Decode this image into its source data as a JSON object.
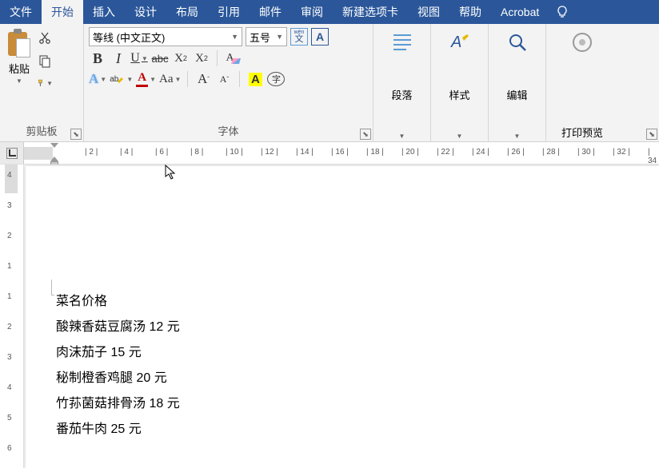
{
  "menu": {
    "file": "文件",
    "home": "开始",
    "insert": "插入",
    "design": "设计",
    "layout": "布局",
    "references": "引用",
    "mailings": "邮件",
    "review": "审阅",
    "new_tab": "新建选项卡",
    "view": "视图",
    "help": "帮助",
    "acrobat": "Acrobat"
  },
  "ribbon": {
    "clipboard": {
      "paste": "粘贴",
      "group_label": "剪贴板"
    },
    "font": {
      "name": "等线 (中文正文)",
      "size": "五号",
      "wen_top": "wén",
      "wen_bottom": "文",
      "group_label": "字体",
      "aa": "Aa"
    },
    "paragraph": {
      "label": "段落"
    },
    "styles": {
      "label": "样式"
    },
    "editing": {
      "label": "编辑"
    },
    "print_preview": {
      "label": "打印预览"
    }
  },
  "ruler": {
    "ticks": [
      "2",
      "4",
      "6",
      "8",
      "10",
      "12",
      "14",
      "16",
      "18",
      "20",
      "22",
      "24",
      "26",
      "28",
      "30",
      "32",
      "34"
    ]
  },
  "v_ruler": {
    "ticks": [
      "4",
      "3",
      "2",
      "1",
      "1",
      "2",
      "3",
      "4",
      "5",
      "6"
    ]
  },
  "document": {
    "lines": [
      "菜名价格",
      "酸辣香菇豆腐汤 12 元",
      "肉沫茄子 15 元",
      "秘制橙香鸡腿 20 元",
      "竹荪菌菇排骨汤 18 元",
      "番茄牛肉 25 元"
    ]
  }
}
